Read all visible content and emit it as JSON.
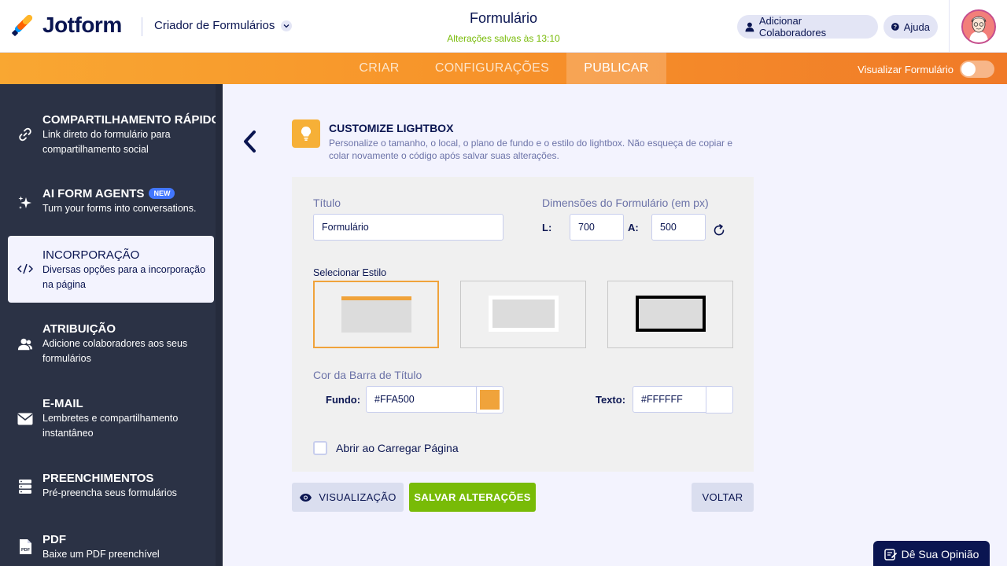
{
  "header": {
    "logo_text": "Jotform",
    "builder_label": "Criador de Formulários",
    "form_title": "Formulário",
    "saved_status": "Alterações salvas às 13:10",
    "add_collaborators": "Adicionar Colaboradores",
    "help": "Ajuda"
  },
  "nav": {
    "tabs": [
      {
        "label": "CRIAR",
        "active": false
      },
      {
        "label": "CONFIGURAÇÕES",
        "active": false
      },
      {
        "label": "PUBLICAR",
        "active": true
      }
    ],
    "preview_label": "Visualizar Formulário",
    "preview_enabled": false
  },
  "sidebar": {
    "items": [
      {
        "title": "COMPARTILHAMENTO RÁPIDO",
        "desc": "Link direto do formulário para compartilhamento social",
        "icon": "link-icon"
      },
      {
        "title": "AI FORM AGENTS",
        "badge": "NEW",
        "desc": "Turn your forms into conversations.",
        "icon": "sparkle-icon"
      },
      {
        "title": "INCORPORAÇÃO",
        "desc": "Diversas opções para a incorporação na página",
        "icon": "code-icon",
        "active": true
      },
      {
        "title": "ATRIBUIÇÃO",
        "desc": "Adicione colaboradores aos seus formulários",
        "icon": "users-icon"
      },
      {
        "title": "E-MAIL",
        "desc": "Lembretes e compartilhamento instantâneo",
        "icon": "envelope-icon"
      },
      {
        "title": "PREENCHIMENTOS",
        "desc": "Pré-preencha seus formulários",
        "icon": "database-icon"
      },
      {
        "title": "PDF",
        "desc": "Baixe um PDF preenchível",
        "icon": "pdf-icon"
      }
    ]
  },
  "main": {
    "section_title": "CUSTOMIZE LIGHTBOX",
    "section_desc": "Personalize o tamanho, o local, o plano de fundo e o estilo do lightbox. Não esqueça de copiar e colar novamente o código após salvar suas alterações.",
    "title_label": "Título",
    "title_value": "Formulário",
    "dimensions_label": "Dimensões do Formulário (em px)",
    "width_label": "L:",
    "width_value": "700",
    "height_label": "A:",
    "height_value": "500",
    "style_label": "Selecionar Estilo",
    "selected_style": 1,
    "titlebar_color_label": "Cor da Barra de Título",
    "bg_label": "Fundo:",
    "bg_value": "#FFA500",
    "bg_color": "#F0A33B",
    "text_label": "Texto:",
    "text_value": "#FFFFFF",
    "text_color": "#FFFFFF",
    "open_on_load_label": "Abrir ao Carregar Página",
    "open_on_load_checked": false,
    "btn_preview": "VISUALIZAÇÃO",
    "btn_save": "SALVAR ALTERAÇÕES",
    "btn_back": "VOLTAR"
  },
  "feedback": {
    "label": "Dê Sua Opinião"
  }
}
